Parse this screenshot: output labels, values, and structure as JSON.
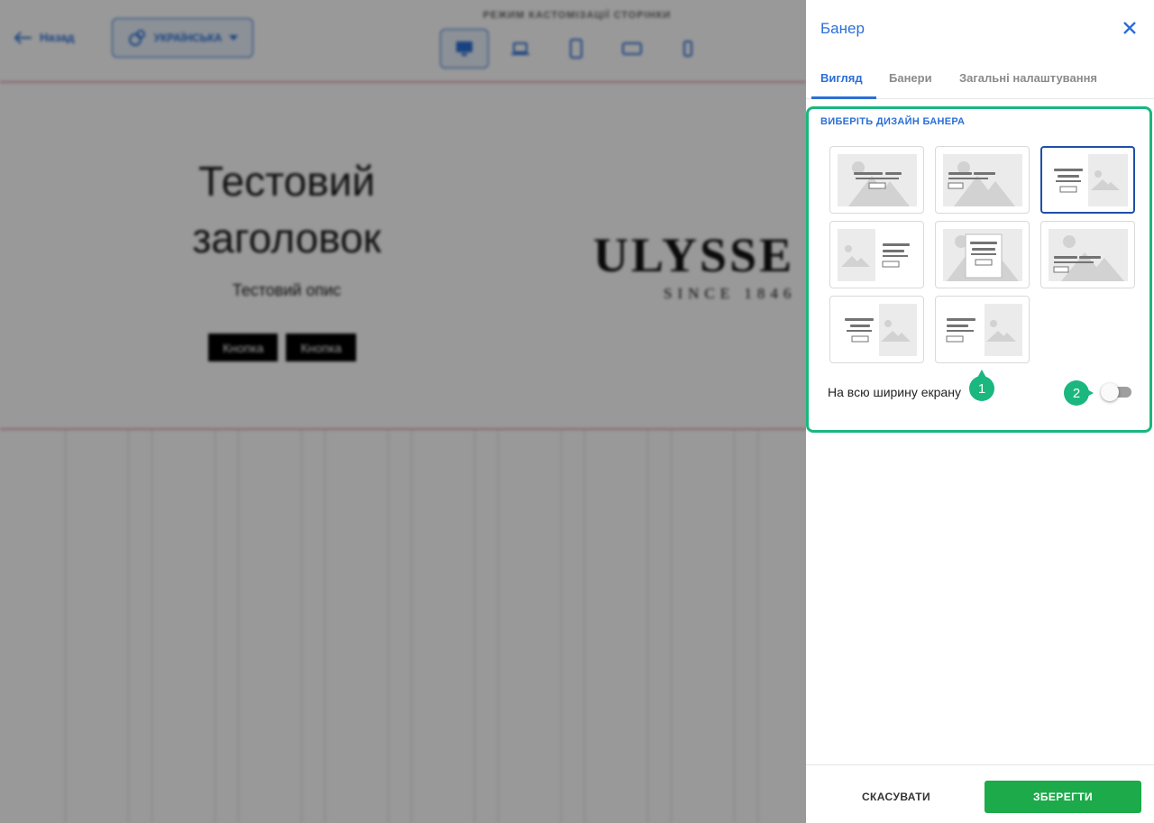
{
  "editor": {
    "back_label": "Назад",
    "language_label": "УКРАЇНСЬКА",
    "mode_label": "РЕЖИМ КАСТОМІЗАЦІЇ СТОРІНКИ",
    "devices": [
      "desktop-icon",
      "laptop-icon",
      "tablet-icon",
      "tablet-landscape-icon",
      "mobile-icon"
    ],
    "banner": {
      "title": "Тестовий заголовок",
      "description": "Тестовий опис",
      "buttons": [
        "Кнопка",
        "Кнопка"
      ],
      "logo_word": "ULYSSE",
      "logo_sub": "SINCE 1846"
    }
  },
  "panel": {
    "title": "Банер",
    "tabs": [
      {
        "label": "Вигляд",
        "active": true
      },
      {
        "label": "Банери",
        "active": false
      },
      {
        "label": "Загальні налаштування",
        "active": false
      }
    ],
    "section_label": "ВИБЕРІТЬ ДИЗАЙН БАНЕРА",
    "designs_count": 8,
    "selected_design_index": 2,
    "full_width_label": "На всю ширину екрану",
    "full_width_enabled": false,
    "markers": [
      "1",
      "2"
    ],
    "cancel_label": "СКАСУВАТИ",
    "save_label": "ЗБЕРЕГТИ"
  },
  "colors": {
    "accent": "#2b6fd6",
    "highlight": "#1ab77f",
    "save": "#1caa4a"
  }
}
